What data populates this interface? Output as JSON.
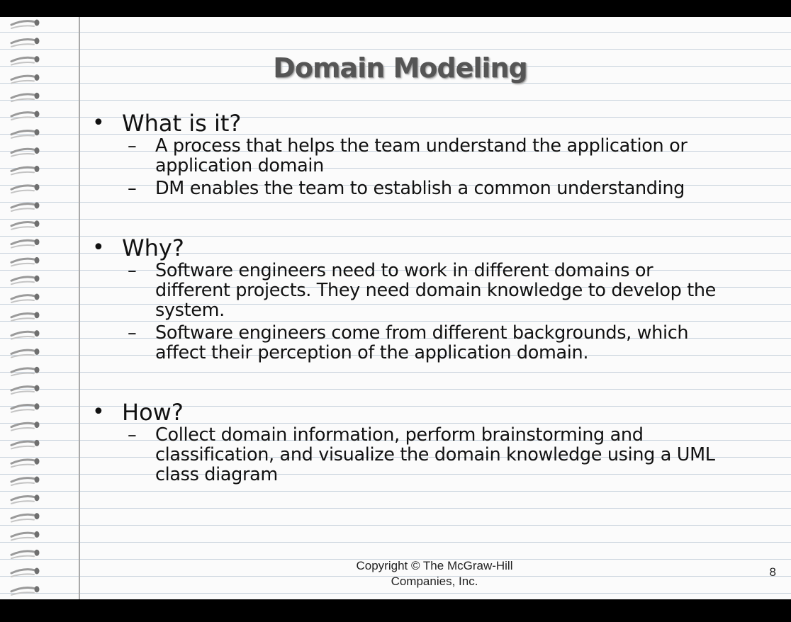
{
  "slide": {
    "title": "Domain Modeling",
    "sections": [
      {
        "heading": "What is it?",
        "points": [
          [
            "A process that helps the team understand the application or",
            "application domain"
          ],
          [
            "DM enables the team to establish a common understanding"
          ]
        ]
      },
      {
        "heading": "Why?",
        "points": [
          [
            "Software engineers need to work in different domains or",
            "different projects. They need domain knowledge to develop the",
            "system."
          ],
          [
            "Software engineers come from different backgrounds, which",
            "affect their perception of the application domain."
          ]
        ]
      },
      {
        "heading": "How?",
        "points": [
          [
            "Collect domain information, perform brainstorming and",
            "classification, and visualize the domain knowledge using a UML",
            "class diagram"
          ]
        ]
      }
    ],
    "footer": {
      "line1": "Copyright © The McGraw-Hill",
      "line2": "Companies, Inc."
    },
    "page_number": "8",
    "bullet_glyph": "•",
    "dash_glyph": "–"
  }
}
